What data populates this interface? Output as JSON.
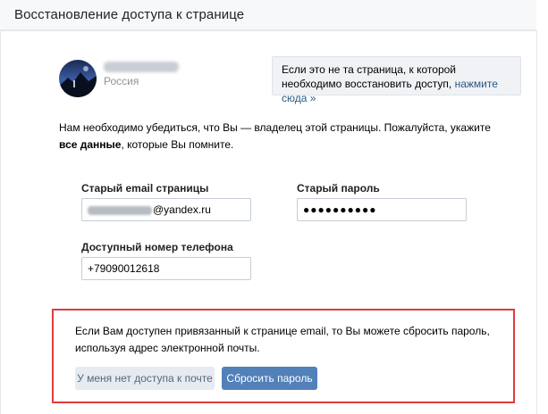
{
  "header": {
    "title": "Восстановление доступа к странице"
  },
  "profile": {
    "country": "Россия"
  },
  "notice": {
    "text": "Если это не та страница, к которой необходимо восстановить доступ, ",
    "link": "нажмите сюда »"
  },
  "intro": {
    "text_before": "Нам необходимо убедиться, что Вы — владелец этой страницы. Пожалуйста, укажите ",
    "bold": "все данные",
    "text_after": ", которые Вы помните."
  },
  "form": {
    "old_email": {
      "label": "Старый email страницы",
      "value_visible": "@yandex.ru"
    },
    "old_password": {
      "label": "Старый пароль",
      "value_masked": "●●●●●●●●●●"
    },
    "phone": {
      "label": "Доступный номер телефона",
      "value": "+79090012618"
    }
  },
  "reset": {
    "text": "Если Вам доступен привязанный к странице email, то Вы можете сбросить пароль, используя адрес электронной почты.",
    "no_access_button": "У меня нет доступа к почте",
    "reset_button": "Сбросить пароль"
  },
  "colors": {
    "accent": "#5181b8",
    "link": "#2a5885",
    "highlight_border": "#e23b3b"
  }
}
